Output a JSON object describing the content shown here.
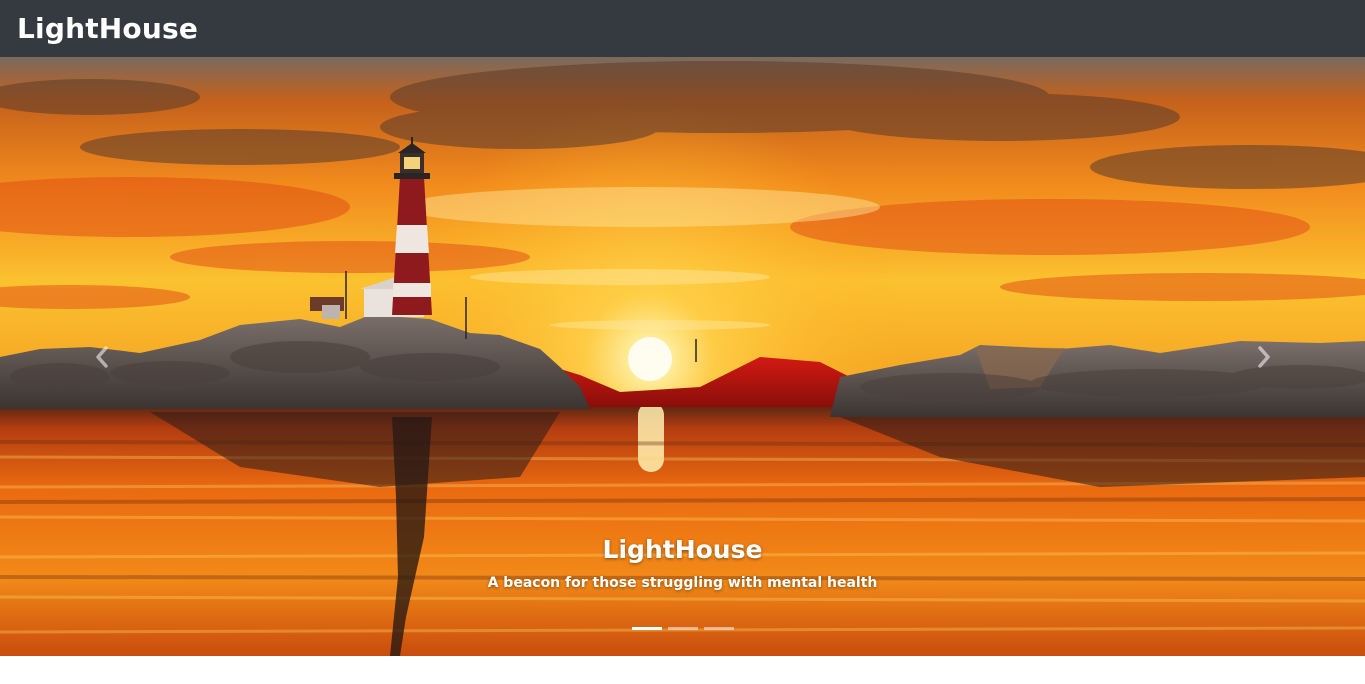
{
  "navbar": {
    "brand": "LightHouse",
    "background": "#343a40"
  },
  "carousel": {
    "image": "lighthouse-sunset-photo",
    "caption": {
      "title": "LightHouse",
      "subtitle": "A beacon for those struggling with mental health"
    },
    "controls": {
      "prev_icon": "chevron-left-icon",
      "next_icon": "chevron-right-icon"
    },
    "indicators": [
      {
        "active": true
      },
      {
        "active": false
      },
      {
        "active": false
      }
    ]
  },
  "colors": {
    "sky_top": "#d9561a",
    "sky_mid": "#f7a21f",
    "sun": "#fff6c8",
    "water": "#e8620f",
    "rocks": "#5e5450",
    "lighthouse_red": "#8e1a1e"
  }
}
